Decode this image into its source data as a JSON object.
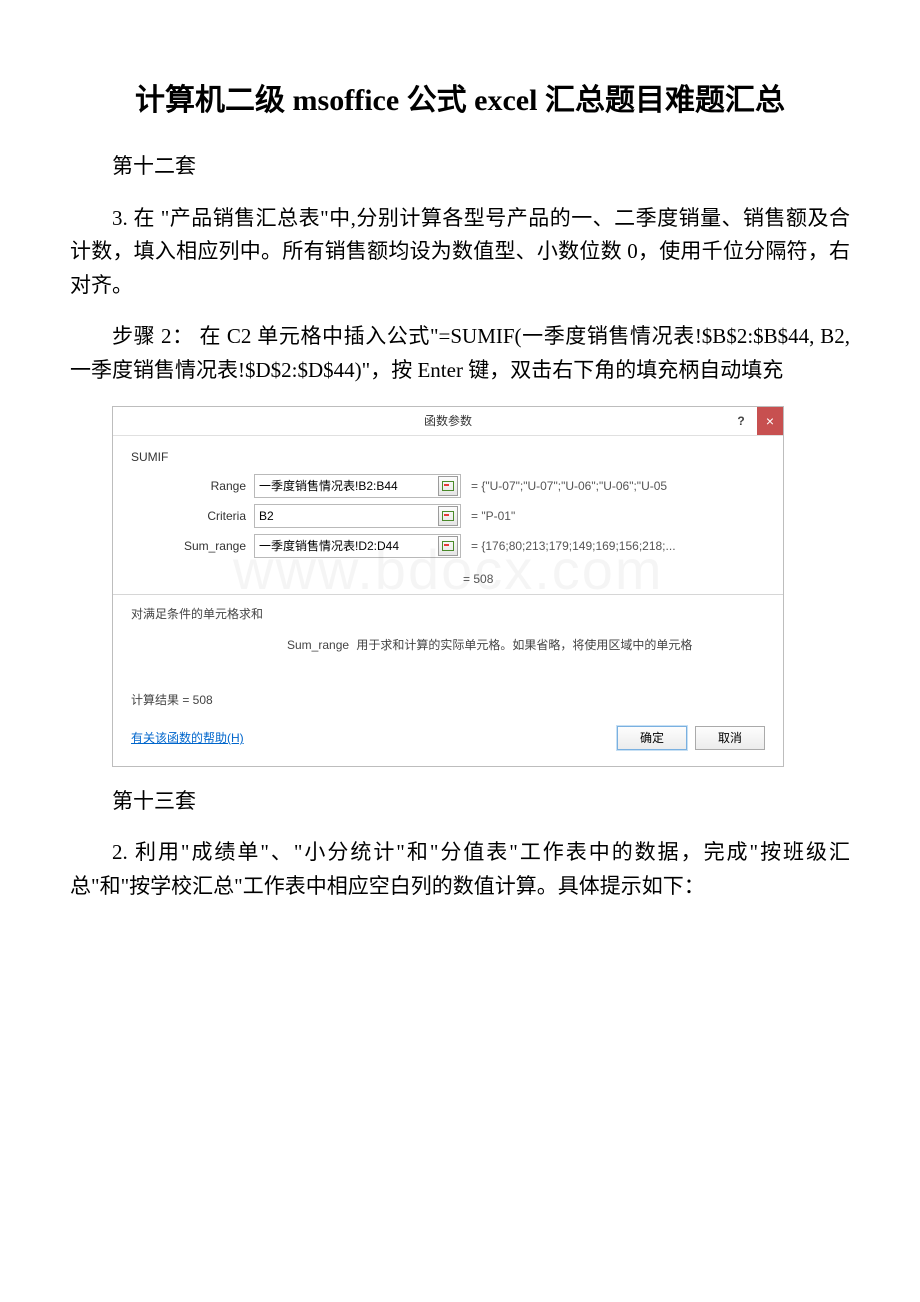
{
  "title": "计算机二级 msoffice 公式 excel 汇总题目难题汇总",
  "section1_heading": "第十二套",
  "section1_task": "3. 在 \"产品销售汇总表\"中,分别计算各型号产品的一、二季度销量、销售额及合计数，填入相应列中。所有销售额均设为数值型、小数位数 0，使用千位分隔符，右对齐。",
  "section1_step": "步骤 2： 在 C2 单元格中插入公式\"=SUMIF(一季度销售情况表!$B$2:$B$44, B2,一季度销售情况表!$D$2:$D$44)\"，按 Enter 键，双击右下角的填充柄自动填充",
  "dialog": {
    "title": "函数参数",
    "help_icon": "?",
    "close_icon": "×",
    "function_name": "SUMIF",
    "args": [
      {
        "label": "Range",
        "value": "一季度销售情况表!B2:B44",
        "eval": "=  {\"U-07\";\"U-07\";\"U-06\";\"U-06\";\"U-05"
      },
      {
        "label": "Criteria",
        "value": "B2",
        "eval": "=  \"P-01\""
      },
      {
        "label": "Sum_range",
        "value": "一季度销售情况表!D2:D44",
        "eval": "=  {176;80;213;179;149;169;156;218;..."
      }
    ],
    "result_eq": "=  508",
    "description": "对满足条件的单元格求和",
    "arg_description_label": "Sum_range",
    "arg_description_text": "用于求和计算的实际单元格。如果省略，将使用区域中的单元格",
    "calc_result": "计算结果 =  508",
    "help_link": "有关该函数的帮助(H)",
    "ok": "确定",
    "cancel": "取消",
    "watermark": "www.bdocx.com"
  },
  "section2_heading": "第十三套",
  "section2_task": "2. 利用\"成绩单\"、\"小分统计\"和\"分值表\"工作表中的数据，完成\"按班级汇总\"和\"按学校汇总\"工作表中相应空白列的数值计算。具体提示如下："
}
